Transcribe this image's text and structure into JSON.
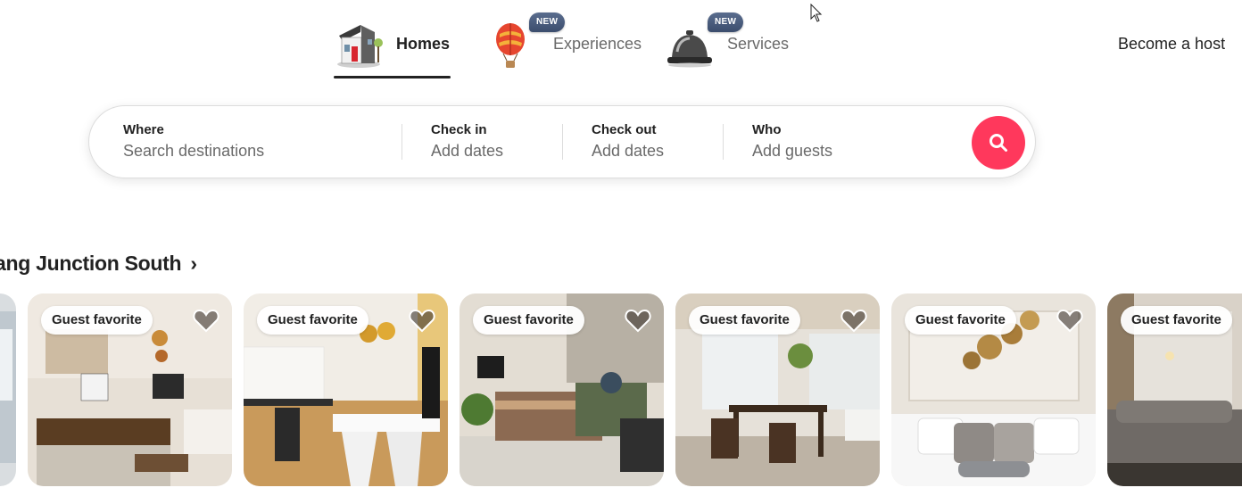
{
  "nav": {
    "tabs": [
      {
        "label": "Homes",
        "icon": "house-icon",
        "badge": "",
        "active": true
      },
      {
        "label": "Experiences",
        "icon": "hot-air-balloon-icon",
        "badge": "NEW",
        "active": false
      },
      {
        "label": "Services",
        "icon": "service-bell-icon",
        "badge": "NEW",
        "active": false
      }
    ],
    "host_link": "Become a host"
  },
  "search": {
    "where": {
      "title": "Where",
      "value": "Search destinations"
    },
    "checkin": {
      "title": "Check in",
      "value": "Add dates"
    },
    "checkout": {
      "title": "Check out",
      "value": "Add dates"
    },
    "who": {
      "title": "Who",
      "value": "Add guests"
    },
    "button_icon": "magnifier-icon",
    "accent": "#ff385c"
  },
  "section": {
    "title": "ang Junction South",
    "chevron": "›"
  },
  "cards": [
    {
      "badge": "Guest favorite",
      "scene": "kitchen-studio"
    },
    {
      "badge": "Guest favorite",
      "scene": "white-kitchen"
    },
    {
      "badge": "Guest favorite",
      "scene": "bedroom-sofa"
    },
    {
      "badge": "Guest favorite",
      "scene": "dining-room"
    },
    {
      "badge": "Guest favorite",
      "scene": "bed-headboard"
    },
    {
      "badge": "Guest favorite",
      "scene": "living-room"
    }
  ],
  "colors": {
    "text": "#222222",
    "muted": "#6a6a6a",
    "border": "#dddddd",
    "badge_new": "#3b4d6d"
  }
}
